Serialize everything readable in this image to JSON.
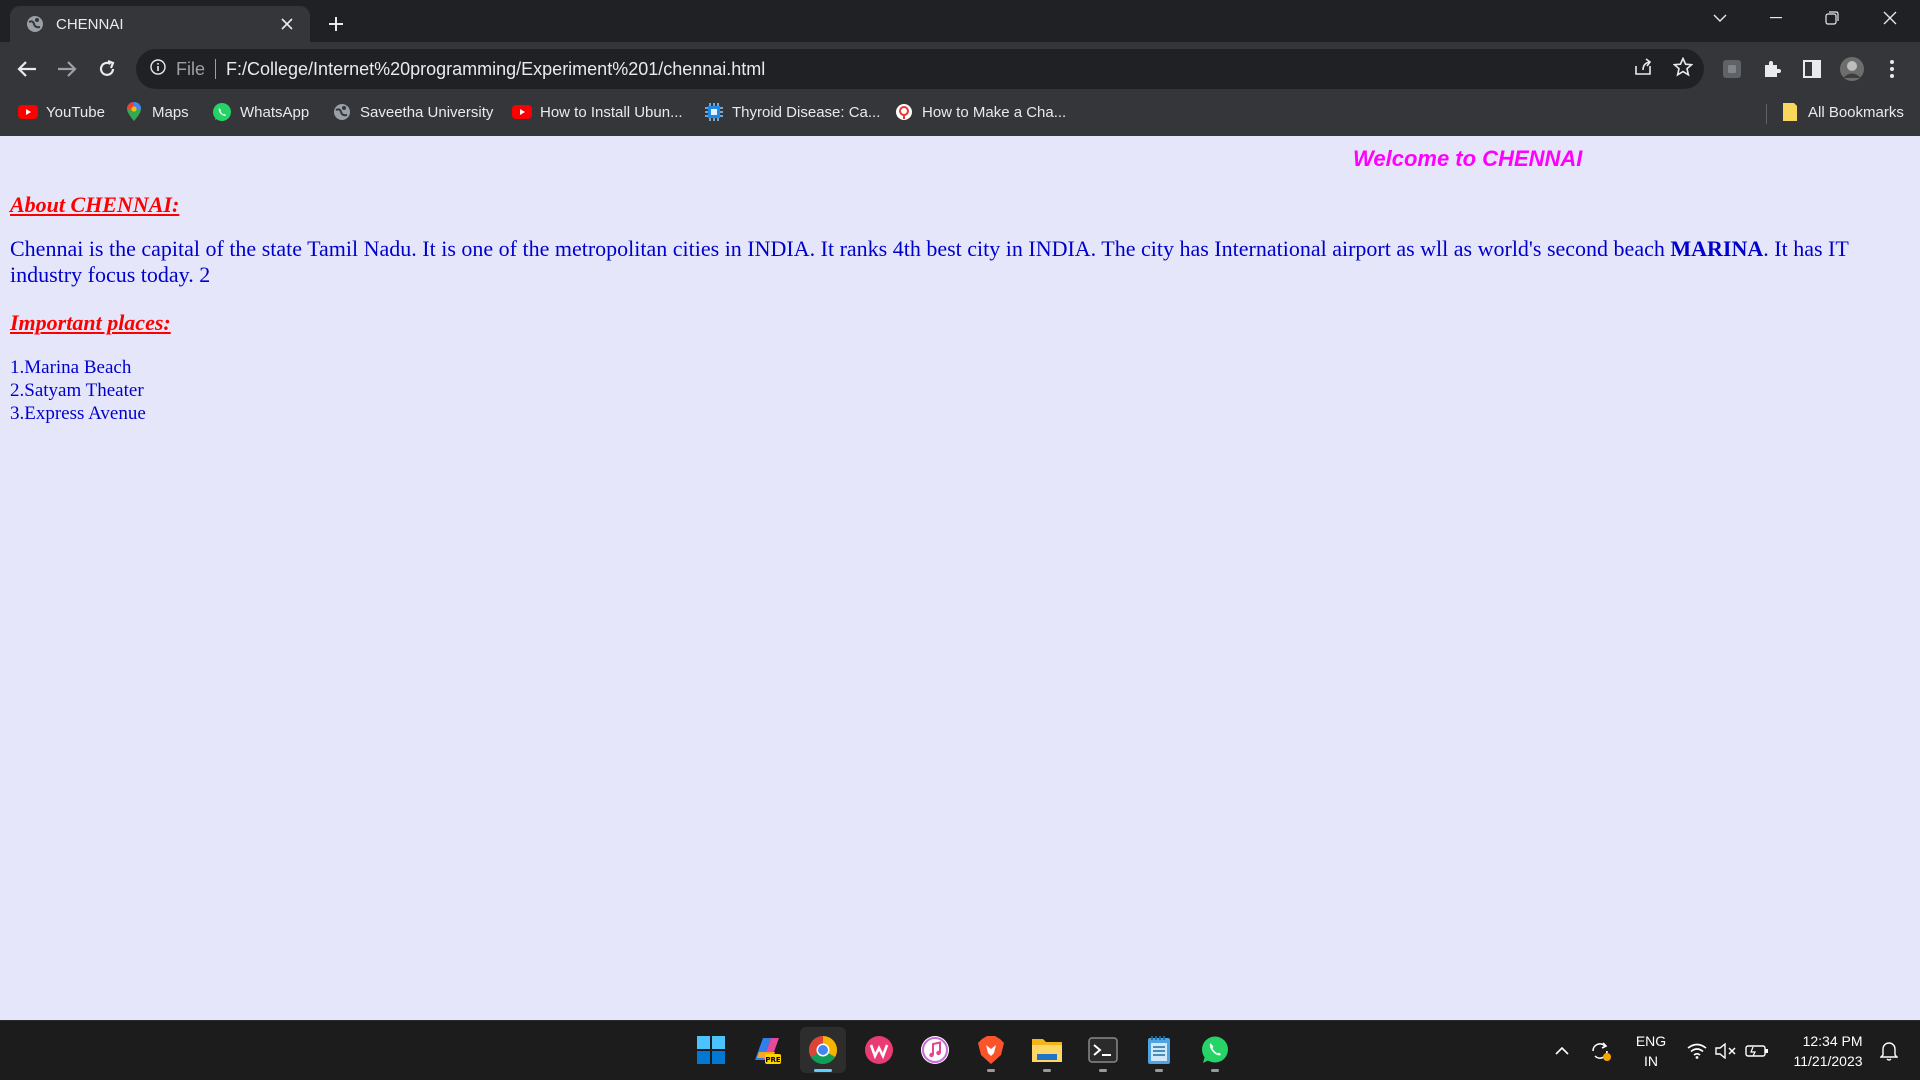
{
  "browser": {
    "tab": {
      "title": "CHENNAI",
      "favicon": "globe-icon"
    },
    "address": {
      "scheme": "File",
      "url": "F:/College/Internet%20programming/Experiment%201/chennai.html"
    },
    "bookmarks": [
      {
        "label": "YouTube",
        "icon": "youtube-icon"
      },
      {
        "label": "Maps",
        "icon": "maps-pin-icon"
      },
      {
        "label": "WhatsApp",
        "icon": "whatsapp-icon"
      },
      {
        "label": "Saveetha University",
        "icon": "globe-icon"
      },
      {
        "label": "How to Install Ubun...",
        "icon": "youtube-icon"
      },
      {
        "label": "Thyroid Disease: Ca...",
        "icon": "chip-icon"
      },
      {
        "label": "How to Make a Cha...",
        "icon": "pin-icon"
      }
    ],
    "all_bookmarks": "All Bookmarks"
  },
  "page": {
    "welcome": "Welcome to CHENNAI",
    "about_heading": "About CHENNAI:",
    "paragraph_before": "Chennai is the capital of the state Tamil Nadu. It is one of the metropolitan cities in INDIA. It ranks 4th best city in INDIA. The city has International airport as wll as world's second beach ",
    "paragraph_bold": "MARINA",
    "paragraph_after": ". It has IT industry focus today. 2",
    "places_heading": "Important places:",
    "places": [
      "1.Marina Beach",
      "2.Satyam Theater",
      "3.Express Avenue"
    ],
    "colors": {
      "background": "#e6e6fa",
      "welcome": "#ff00ff",
      "heading": "#ff0000",
      "body_text": "#0000cd"
    }
  },
  "taskbar": {
    "apps": [
      "windows-start-icon",
      "copilot-pre-icon",
      "chrome-icon",
      "wps-office-icon",
      "itunes-icon",
      "brave-icon",
      "file-explorer-icon",
      "terminal-icon",
      "notepad-icon",
      "whatsapp-icon"
    ],
    "language": {
      "line1": "ENG",
      "line2": "IN"
    },
    "time": "12:34 PM",
    "date": "11/21/2023"
  }
}
